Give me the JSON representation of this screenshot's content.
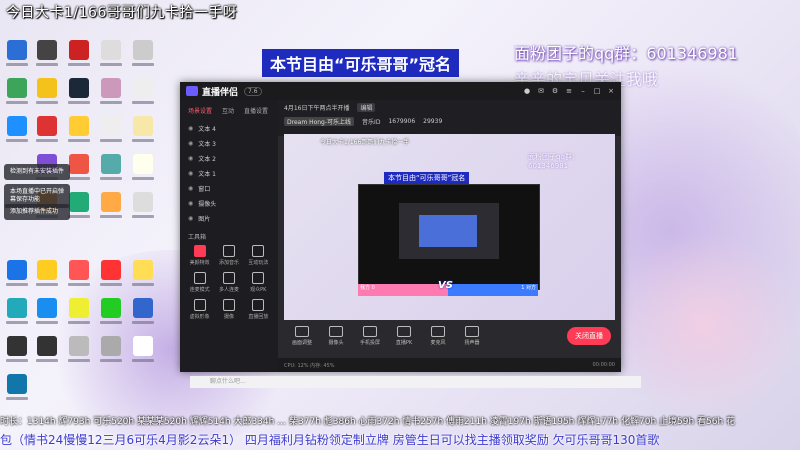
{
  "overlay": {
    "top_title": "今日大卡1/166哥哥们九卡拾一手呀",
    "banner": "本节目由“可乐哥哥”冠名",
    "qq_group": "面粉团子的qq群：601346981",
    "qq_sub": "亲亲的宝贝关注我哦",
    "durations": "时长：1314h 辉793h 可乐520h 某某某520h 辉辉514h 大郎334h … 柴377h 彪386h 心雨372h 情书257h 傅雨211h 凌霄197h 斯语195h 辉辉177h 化解70h 止境59h 看56h 花",
    "ticker": "包（情书24慢慢12三月6可乐4月影2云朵1） 四月福利月钻粉领定制立牌 房管生日可以找主播领取奖励 欠可乐哥哥130首歌"
  },
  "notifications": [
    "检测到有未安装插件",
    "本场直播中已开启弹幕保存功能",
    "添加推荐插件成功"
  ],
  "app": {
    "name": "直播伴侣",
    "version": "7.6",
    "side_tabs": [
      "场景设置",
      "互动",
      "直播设置"
    ],
    "scenes": [
      "文本 4",
      "文本 3",
      "文本 2",
      "文本 1",
      "窗口",
      "摄像头",
      "图片"
    ],
    "tools_label": "工具箱",
    "tools": [
      "美颜特效",
      "添加音乐",
      "互动玩法",
      "连麦模式",
      "多人连麦",
      "观众PK",
      "虚拟形象",
      "摄像",
      "直播回放",
      "更多"
    ],
    "info": {
      "date": "4月16日下午两点半开播",
      "edit": "编辑",
      "tag": "Dream Hong-可乐上线",
      "id_label": "音乐ID",
      "id": "1679906",
      "followers": "29939"
    },
    "preview_banner": "本节目由“可乐哥哥”冠名",
    "preview_title": "今日大卡1/166哥哥们九卡拾一手",
    "preview_qq": "面粉团子qq群：601346981",
    "pk": {
      "left": "我方 0",
      "right": "1 对方",
      "vs": "VS"
    },
    "controls": [
      "画面调整",
      "摄像头",
      "手机投屏",
      "直播PK",
      "麦克风",
      "扬声器"
    ],
    "live_button": "关闭直播",
    "status_left": "CPU: 12%  内存: 45%",
    "status_right": "00:00:00",
    "chat_placeholder": "聊点什么吧..."
  }
}
